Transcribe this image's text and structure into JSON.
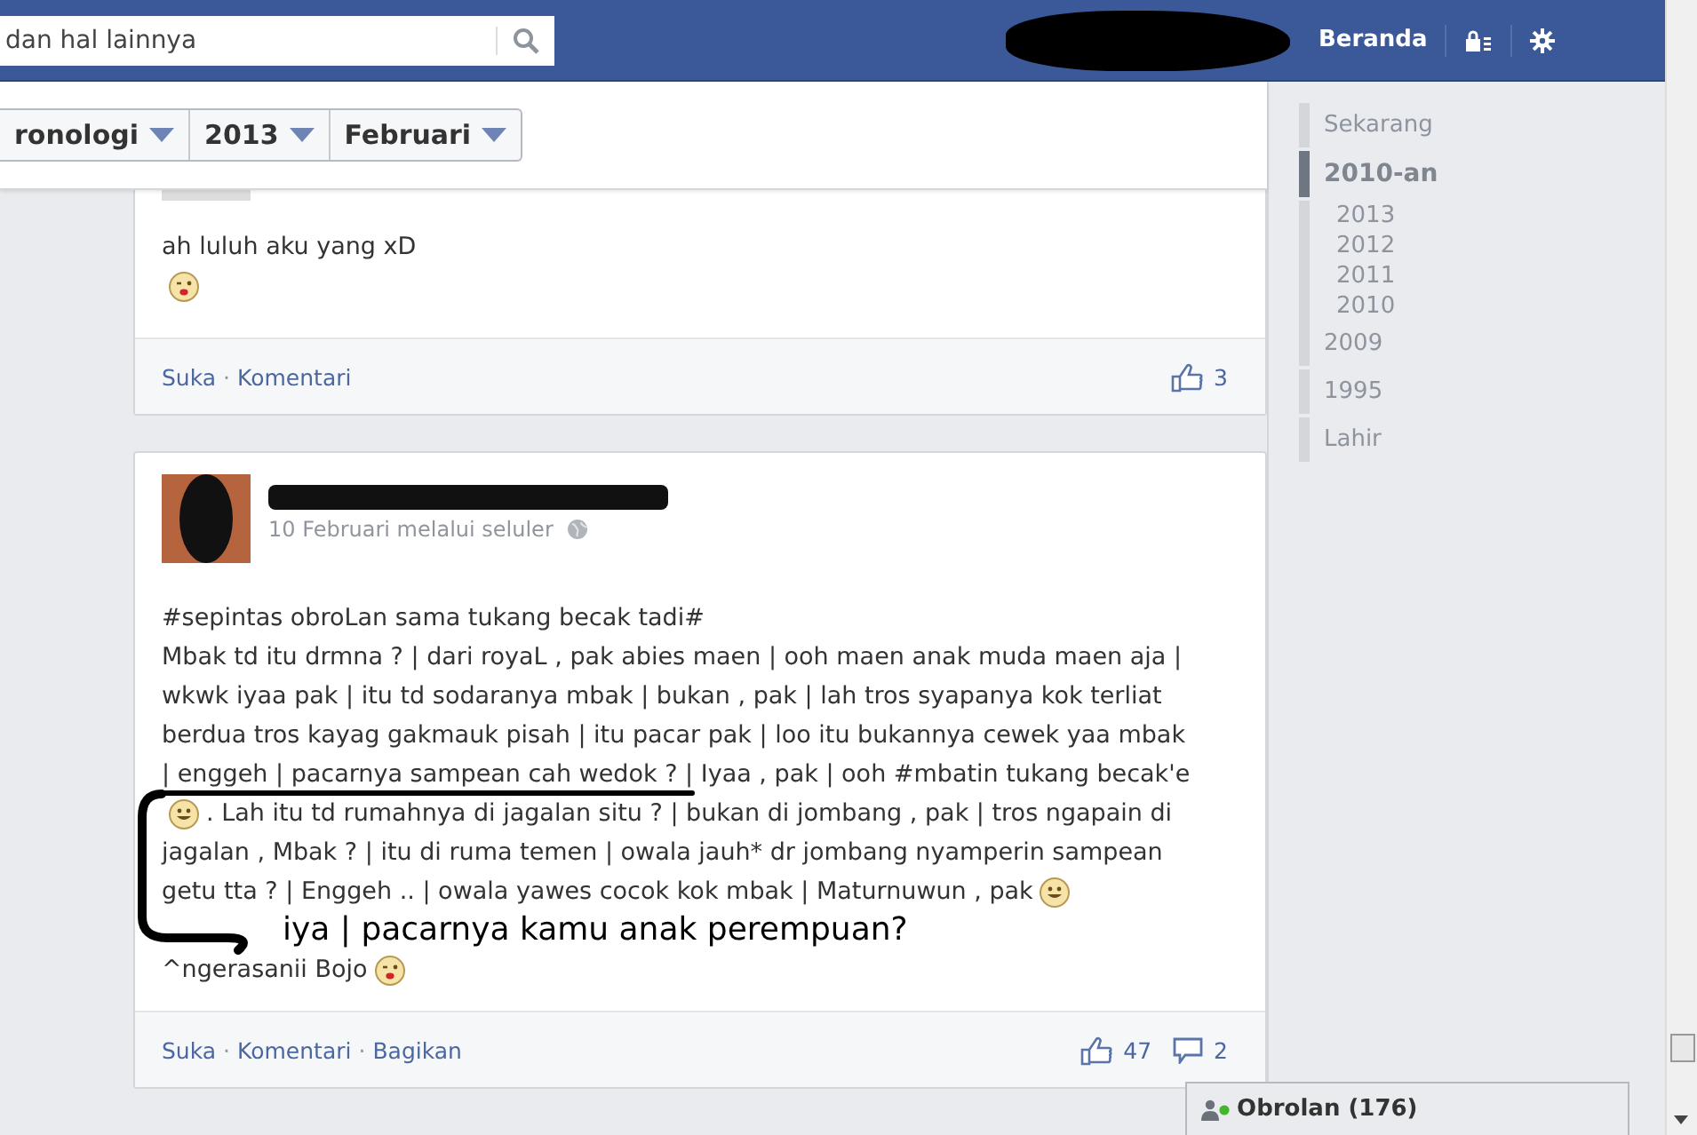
{
  "topbar": {
    "search": {
      "value": "dan hal lainnya"
    },
    "home_link": "Beranda"
  },
  "filters": [
    {
      "label": "ronologi"
    },
    {
      "label": "2013"
    },
    {
      "label": "Februari"
    }
  ],
  "posts": [
    {
      "lines": [
        [
          {
            "kind": "text",
            "text": "ah luluh aku yang xD"
          }
        ],
        [
          {
            "kind": "kiss"
          }
        ]
      ],
      "footer": {
        "actions": [
          {
            "kind": "link",
            "text": "Suka"
          },
          {
            "kind": "sep",
            "text": "·"
          },
          {
            "kind": "link",
            "text": "Komentari"
          }
        ],
        "likes": "3"
      }
    },
    {
      "author": {
        "date": "10 Februari melalui seluler"
      },
      "lines": [
        [
          {
            "kind": "text",
            "text": "#sepintas obroLan sama tukang becak tadi#"
          }
        ],
        [
          {
            "kind": "text",
            "text": "Mbak td itu drmna ? | dari royaL , pak abies maen | ooh maen anak muda maen aja |"
          }
        ],
        [
          {
            "kind": "text",
            "text": "wkwk iyaa pak | itu td sodaranya mbak | bukan , pak | lah tros syapanya kok terliat"
          }
        ],
        [
          {
            "kind": "text",
            "text": "berdua tros kayag gakmauk pisah | itu pacar pak | loo itu bukannya cewek yaa mbak"
          }
        ],
        [
          {
            "kind": "text",
            "text": "| enggeh | pacarnya sampean cah wedok ? | Iyaa , pak | ooh #mbatin tukang becak'e"
          }
        ],
        [
          {
            "kind": "smile"
          },
          {
            "kind": "text",
            "text": ". Lah itu td rumahnya di jagalan situ ? | bukan di jombang , pak | tros ngapain di"
          }
        ],
        [
          {
            "kind": "text",
            "text": "jagalan , Mbak ? | itu di ruma temen | owala jauh* dr jombang nyamperin sampean"
          }
        ],
        [
          {
            "kind": "text",
            "text": "getu tta ? | Enggeh .. | owala yawes cocok kok mbak | Maturnuwun , pak"
          },
          {
            "kind": "smile"
          }
        ],
        [
          {
            "kind": "handwriting",
            "text": "iya | pacarnya kamu anak perempuan?"
          }
        ],
        [
          {
            "kind": "text",
            "text": "^ngerasanii Bojo"
          },
          {
            "kind": "kiss"
          }
        ]
      ],
      "footer": {
        "actions": [
          {
            "kind": "link",
            "text": "Suka"
          },
          {
            "kind": "sep",
            "text": "·"
          },
          {
            "kind": "link",
            "text": "Komentari"
          },
          {
            "kind": "sep",
            "text": "·"
          },
          {
            "kind": "link",
            "text": "Bagikan"
          }
        ],
        "likes": "47",
        "comments": "2"
      }
    }
  ],
  "timeline": [
    {
      "label": "Sekarang",
      "selected": false
    },
    {
      "label": "2010-an",
      "selected": true,
      "children": [
        {
          "label": "2013"
        },
        {
          "label": "2012"
        },
        {
          "label": "2011"
        },
        {
          "label": "2010"
        }
      ]
    },
    {
      "label": "2009",
      "selected": false
    },
    {
      "label": "1995",
      "selected": false
    },
    {
      "label": "Lahir",
      "selected": false
    }
  ],
  "chat": {
    "label": "Obrolan (176)"
  }
}
